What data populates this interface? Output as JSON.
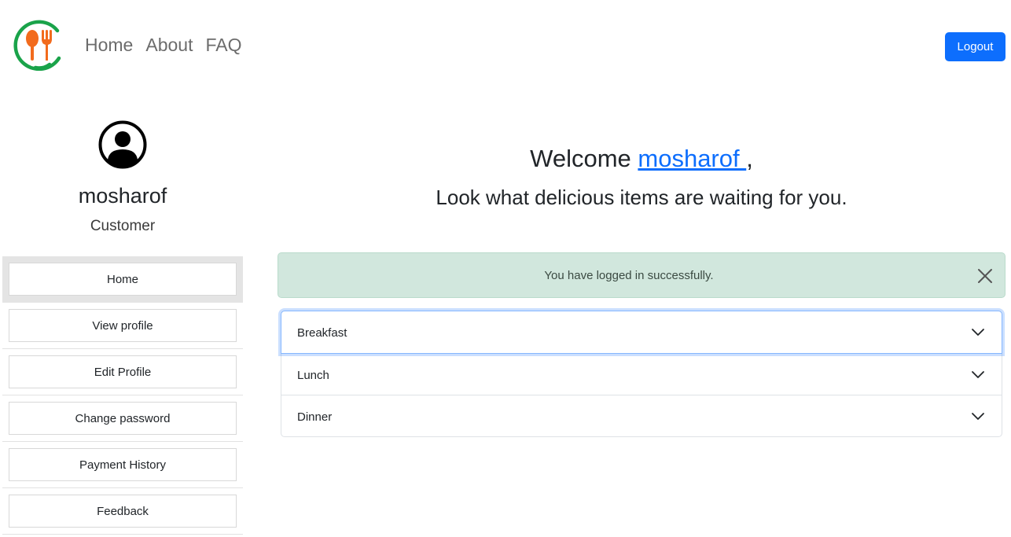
{
  "brand": {
    "logo_icon": "spoon-fork-logo-icon",
    "colors": {
      "ring": "#1aa34a",
      "utensils": "#f26b1d"
    }
  },
  "nav": {
    "links": [
      "Home",
      "About",
      "FAQ"
    ],
    "logout_label": "Logout"
  },
  "sidebar": {
    "avatar_icon": "user-circle-icon",
    "username": "mosharof",
    "role": "Customer",
    "menu": [
      {
        "label": "Home",
        "active": true
      },
      {
        "label": "View profile"
      },
      {
        "label": "Edit Profile"
      },
      {
        "label": "Change password"
      },
      {
        "label": "Payment History"
      },
      {
        "label": "Feedback"
      }
    ]
  },
  "main": {
    "welcome_prefix": "Welcome ",
    "welcome_user": "mosharof ",
    "welcome_suffix": ",",
    "tagline": "Look what delicious items are waiting for you.",
    "alert": {
      "text": "You have logged in successfully.",
      "close_icon": "close-icon"
    },
    "accordion": [
      {
        "label": "Breakfast",
        "focused": true
      },
      {
        "label": "Lunch"
      },
      {
        "label": "Dinner"
      }
    ]
  },
  "colors": {
    "primary": "#0d6efd",
    "alert_bg": "#d1e7dd"
  }
}
